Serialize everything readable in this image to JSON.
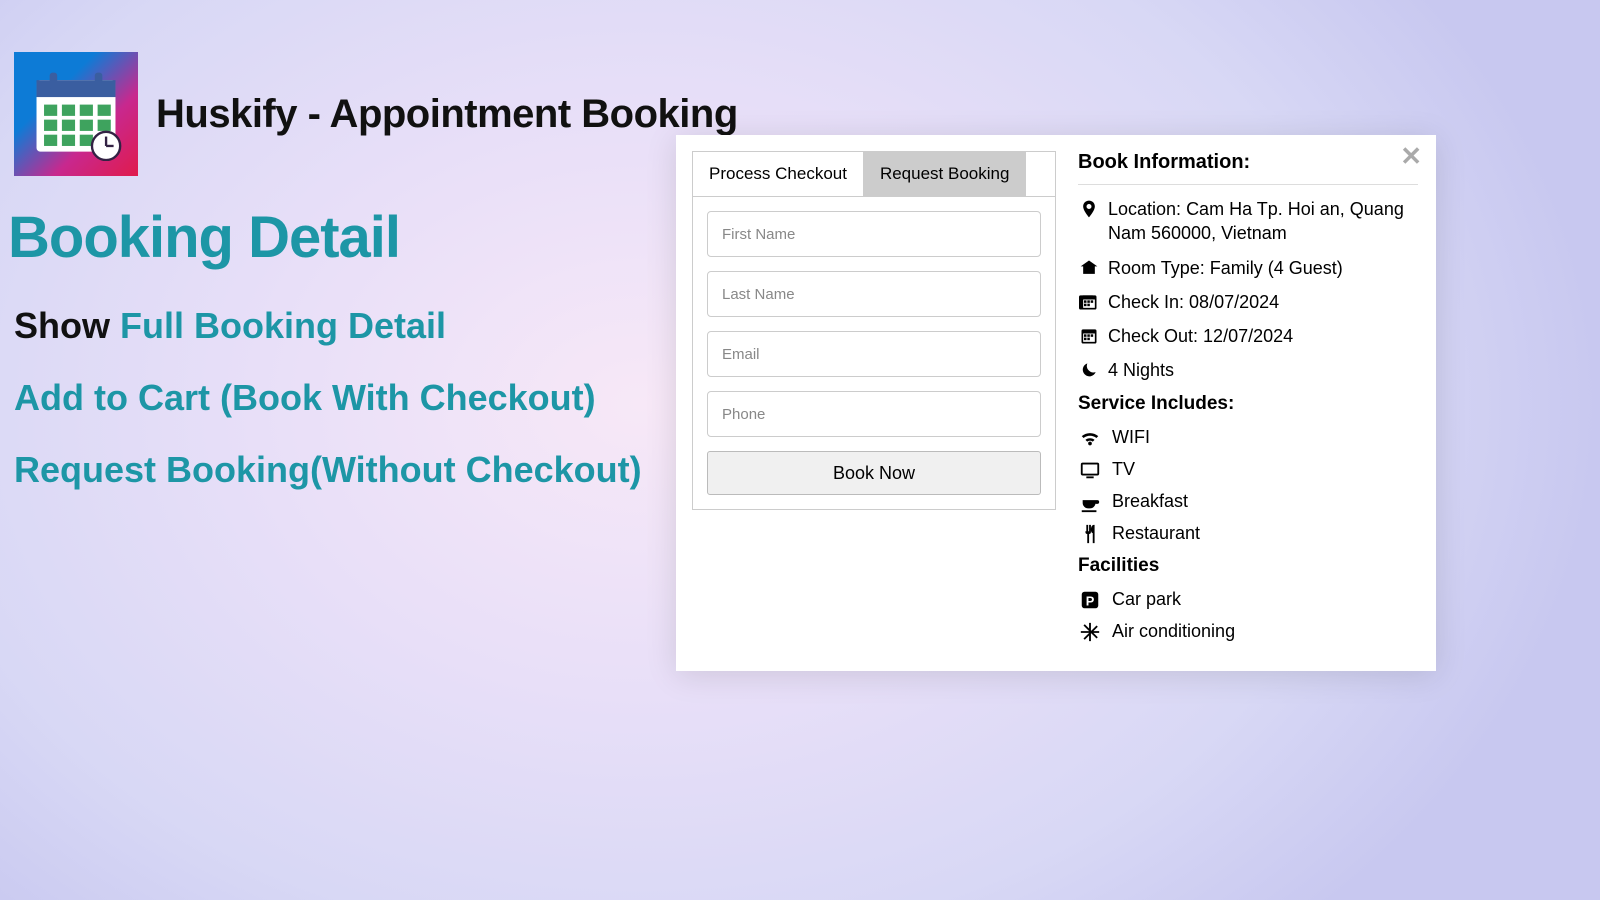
{
  "app": {
    "title": "Huskify - Appointment Booking"
  },
  "heading": "Booking Detail",
  "lines": {
    "show_prefix": "Show ",
    "show_link": "Full Booking Detail",
    "add_to_cart": "Add to Cart (Book With Checkout)",
    "request_booking": "Request Booking(Without Checkout)"
  },
  "modal": {
    "tabs": {
      "process": "Process Checkout",
      "request": "Request Booking"
    },
    "placeholders": {
      "first_name": "First Name",
      "last_name": "Last Name",
      "email": "Email",
      "phone": "Phone"
    },
    "book_btn": "Book Now",
    "info_title": "Book Information:",
    "location_label": "Location: ",
    "location_value": "Cam Ha Tp. Hoi an, Quang Nam 560000, Vietnam",
    "room_label": "Room Type: ",
    "room_value": "Family (4 Guest)",
    "checkin_label": "Check In: ",
    "checkin_value": "08/07/2024",
    "checkout_label": "Check Out: ",
    "checkout_value": "12/07/2024",
    "nights": "4 Nights",
    "service_title": "Service Includes:",
    "services": {
      "wifi": "WIFI",
      "tv": "TV",
      "breakfast": "Breakfast",
      "restaurant": "Restaurant"
    },
    "facilities_title": "Facilities",
    "facilities": {
      "carpark": "Car park",
      "ac": "Air conditioning"
    }
  }
}
